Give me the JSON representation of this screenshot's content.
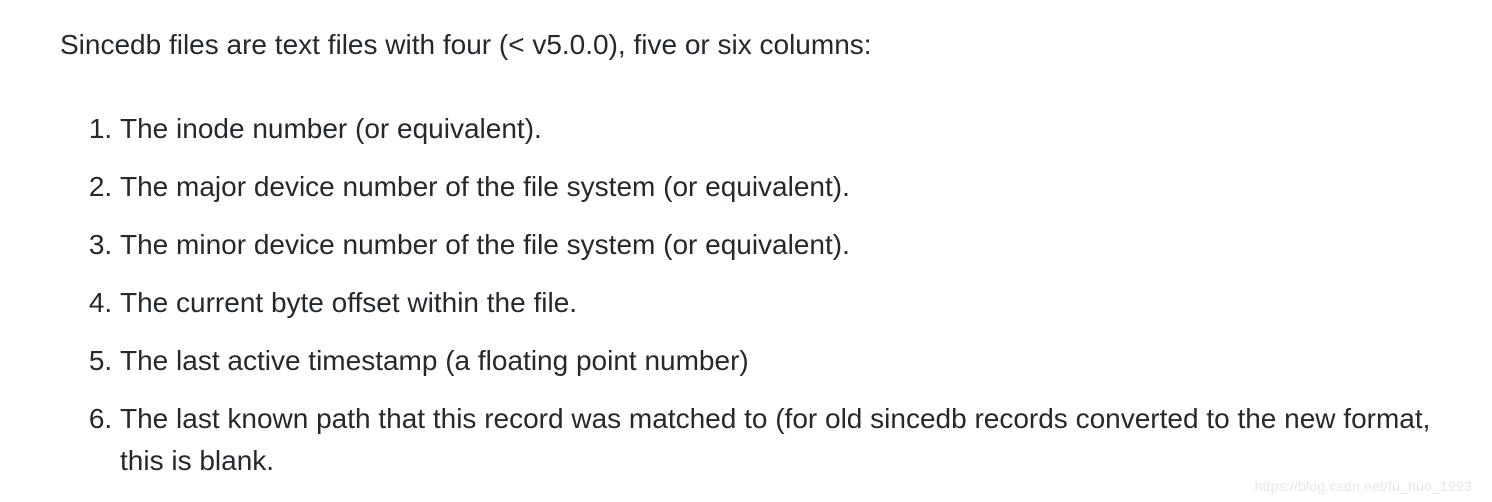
{
  "intro": "Sincedb files are text files with four (< v5.0.0), five or six columns:",
  "items": [
    "The inode number (or equivalent).",
    "The major device number of the file system (or equivalent).",
    "The minor device number of the file system (or equivalent).",
    "The current byte offset within the file.",
    "The last active timestamp (a floating point number)",
    "The last known path that this record was matched to (for old sincedb records converted to the new format, this is blank."
  ],
  "watermark": "https://blog.csdn.net/fu_huo_1993"
}
